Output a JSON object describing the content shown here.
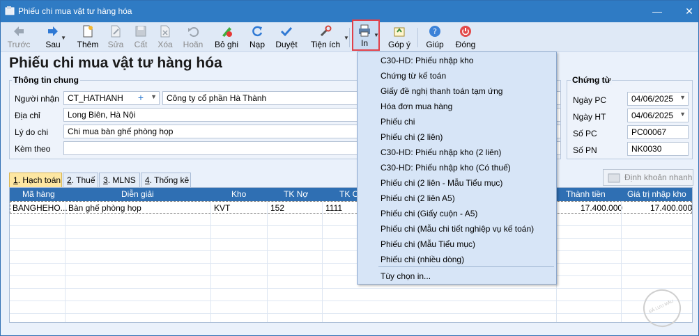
{
  "window": {
    "title": "Phiếu chi mua vật tư hàng hóa"
  },
  "toolbar": {
    "items": [
      {
        "label": "Trước",
        "icon": "arrow-left-icon"
      },
      {
        "label": "Sau",
        "icon": "arrow-right-icon"
      },
      {
        "label": "Thêm",
        "icon": "new-document-icon"
      },
      {
        "label": "Sửa",
        "icon": "edit-icon"
      },
      {
        "label": "Cất",
        "icon": "save-icon"
      },
      {
        "label": "Xóa",
        "icon": "delete-icon"
      },
      {
        "label": "Hoãn",
        "icon": "undo-icon"
      },
      {
        "label": "Bỏ ghi",
        "icon": "unpost-icon"
      },
      {
        "label": "Nạp",
        "icon": "refresh-icon"
      },
      {
        "label": "Duyệt",
        "icon": "check-icon"
      },
      {
        "label": "Tiện ích",
        "icon": "tools-icon"
      },
      {
        "label": "In",
        "icon": "printer-icon"
      },
      {
        "label": "Góp ý",
        "icon": "feedback-icon"
      },
      {
        "label": "Giúp",
        "icon": "help-icon"
      },
      {
        "label": "Đóng",
        "icon": "power-icon"
      }
    ]
  },
  "heading": "Phiếu chi mua vật tư hàng hóa",
  "general": {
    "title": "Thông tin chung",
    "recipient_label": "Người nhận",
    "recipient_code": "CT_HATHANH",
    "recipient_name": "Công ty cổ phần Hà Thành",
    "address_label": "Địa chỉ",
    "address": "Long Biên, Hà Nội",
    "reason_label": "Lý do chi",
    "reason": "Chi mua bàn ghế phòng họp",
    "attach_label": "Kèm theo",
    "attach": ""
  },
  "voucher": {
    "title": "Chứng từ",
    "pc_date_label": "Ngày PC",
    "pc_date": "04/06/2025",
    "ht_date_label": "Ngày HT",
    "ht_date": "04/06/2025",
    "pc_no_label": "Số PC",
    "pc_no": "PC00067",
    "pn_no_label": "Số PN",
    "pn_no": "NK0030"
  },
  "tabs": [
    {
      "key": "1",
      "label": ". Hạch toán"
    },
    {
      "key": "2",
      "label": ". Thuế"
    },
    {
      "key": "3",
      "label": ". MLNS"
    },
    {
      "key": "4",
      "label": ". Thống kê"
    }
  ],
  "quick_entry": "Định khoản nhanh",
  "grid": {
    "columns": [
      "Mã hàng",
      "Diễn giải",
      "Kho",
      "TK Nợ",
      "TK C",
      "Thành tiền",
      "Giá trị nhập kho"
    ],
    "rows": [
      {
        "ma_hang": "BANGHEHO...",
        "dien_giai": "Bàn ghế phòng họp",
        "kho": "KVT",
        "tk_no": "152",
        "tk_co": "1111",
        "thanh_tien": "17.400.000",
        "gia_tri": "17.400.000"
      }
    ]
  },
  "print_menu": [
    "C30-HD: Phiếu nhập kho",
    "Chứng từ kế toán",
    "Giấy đề nghị thanh toán tạm ứng",
    "Hóa đơn mua hàng",
    "Phiếu chi",
    "Phiếu chi (2 liên)",
    "C30-HD: Phiếu nhập kho (2 liên)",
    "C30-HD: Phiếu nhập kho (Có thuế)",
    "Phiếu chi (2 liên - Mẫu Tiểu mục)",
    "Phiếu chi (2 liên A5)",
    "Phiếu chi (Giấy cuộn - A5)",
    "Phiếu chi (Mẫu chi tiết nghiệp vụ kế toán)",
    "Phiếu chi (Mẫu Tiểu mục)",
    "Phiếu chi (nhiều dòng)",
    "Tùy chọn in..."
  ],
  "watermark": "ĐÃ LƯU MẪU"
}
